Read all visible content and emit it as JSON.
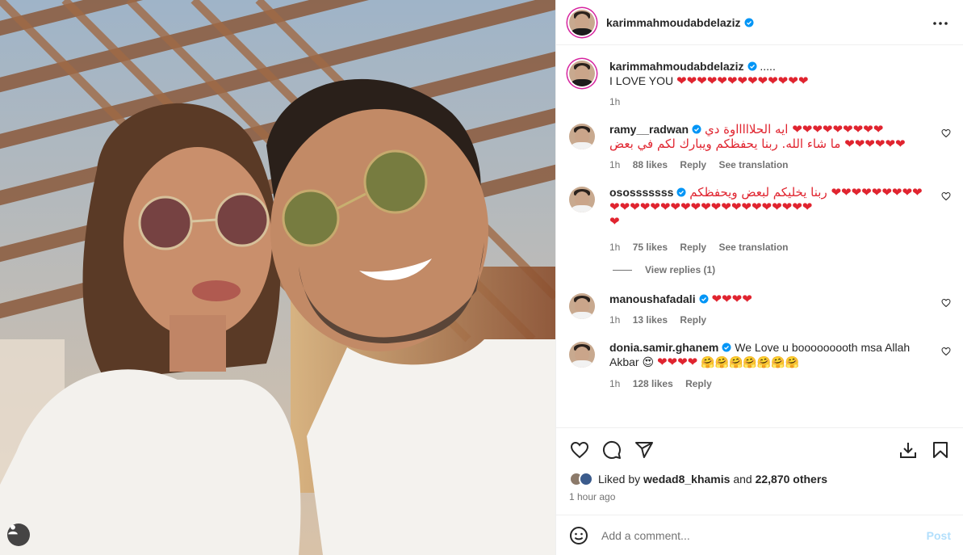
{
  "post": {
    "author": "karimmahmoudabdelaziz",
    "more_icon": "more-horizontal-icon"
  },
  "caption": {
    "username": "karimmahmoudabdelaziz",
    "text_1": ".....",
    "text_2": "I LOVE YOU",
    "hearts": "❤❤❤❤❤❤❤❤❤❤❤❤❤",
    "time": "1h"
  },
  "comments": [
    {
      "username": "ramy__radwan",
      "verified": true,
      "line_1": "ايه الحلاااااوة دي ❤❤❤❤❤❤❤❤❤",
      "line_2": "ما شاء الله. ربنا يحفظكم ويبارك لكم في بعض ❤❤❤❤❤❤",
      "time": "1h",
      "likes": "88 likes",
      "reply": "Reply",
      "translate": "See translation"
    },
    {
      "username": "ososssssss",
      "verified": true,
      "line_1": "ربنا يخليكم لبعض ويحفظكم ❤❤❤❤❤❤❤❤❤",
      "line_2": "❤❤❤❤❤❤❤❤❤❤❤❤❤❤❤❤❤❤❤❤",
      "line_3": "❤",
      "time": "1h",
      "likes": "75 likes",
      "reply": "Reply",
      "translate": "See translation",
      "view_replies": "View replies (1)"
    },
    {
      "username": "manoushafadali",
      "verified": true,
      "line_1": "❤❤❤❤",
      "time": "1h",
      "likes": "13 likes",
      "reply": "Reply"
    },
    {
      "username": "donia.samir.ghanem",
      "verified": true,
      "line_1": "We Love u booooooooth msa Allah",
      "line_2a": "Akbar",
      "line_2_emoji": "😍",
      "line_2_hearts": "❤❤❤❤",
      "line_2_hugs": "🤗🤗🤗🤗🤗🤗🤗",
      "time": "1h",
      "likes": "128 likes",
      "reply": "Reply"
    }
  ],
  "actions": {
    "liked_by_prefix": "Liked by",
    "liked_by_user": "wedad8_khamis",
    "and": "and",
    "others": "22,870 others",
    "time_ago": "1 hour ago"
  },
  "add_comment": {
    "placeholder": "Add a comment...",
    "post_label": "Post"
  },
  "colors": {
    "heart": "#e0242f",
    "verified": "#0095f6",
    "post_disabled": "#b2dffc"
  }
}
